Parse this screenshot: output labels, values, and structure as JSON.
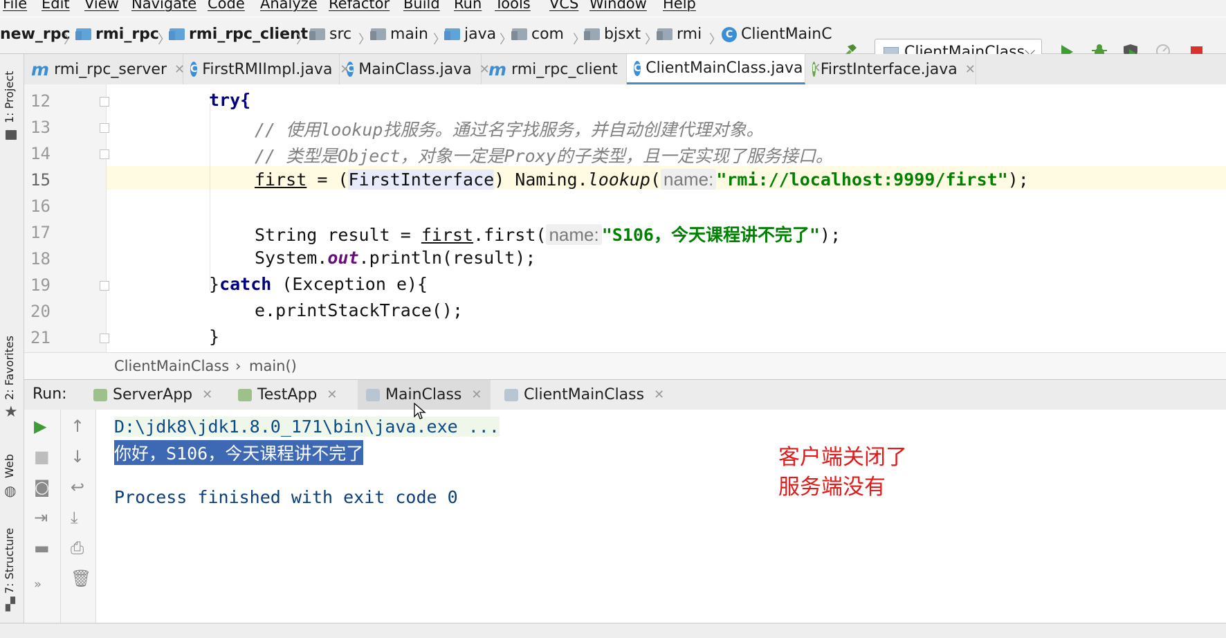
{
  "menu": [
    "File",
    "Edit",
    "View",
    "Navigate",
    "Code",
    "Analyze",
    "Refactor",
    "Build",
    "Run",
    "Tools",
    "VCS",
    "Window",
    "Help"
  ],
  "navbar": {
    "crumbs": [
      "new_rpc",
      "rmi_rpc",
      "rmi_rpc_client",
      "src",
      "main",
      "java",
      "com",
      "bjsxt",
      "rmi",
      "ClientMainC"
    ],
    "run_config": "ClientMainClass"
  },
  "tool_strip": {
    "project": "1: Project",
    "favorites": "2: Favorites",
    "web": "Web",
    "structure": "7: Structure"
  },
  "editor_tabs": [
    {
      "label": "rmi_rpc_server",
      "icon": "maven-module-icon"
    },
    {
      "label": "FirstRMIImpl.java",
      "icon": "class-icon"
    },
    {
      "label": "MainClass.java",
      "icon": "class-icon"
    },
    {
      "label": "rmi_rpc_client",
      "icon": "maven-module-icon"
    },
    {
      "label": "ClientMainClass.java",
      "icon": "class-icon",
      "active": true
    },
    {
      "label": "FirstInterface.java",
      "icon": "interface-icon"
    }
  ],
  "editor": {
    "line_numbers": [
      "12",
      "13",
      "14",
      "15",
      "16",
      "17",
      "18",
      "19",
      "20",
      "21"
    ],
    "current_line": "15",
    "lines": {
      "l12": "try{",
      "l13": "// 使用lookup找服务。通过名字找服务，并自动创建代理对象。",
      "l14": "// 类型是Object，对象一定是Proxy的子类型，且一定实现了服务接口。",
      "l15_var": "first",
      "l15_a": " = (",
      "l15_type": "FirstInterface",
      "l15_b": ") Naming.",
      "l15_method": "lookup",
      "l15_c": "(",
      "l15_hint": "name:",
      "l15_str": "\"rmi://localhost:9999/first\"",
      "l15_end": ");",
      "l17_a": "String result = ",
      "l17_var": "first",
      "l17_b": ".first(",
      "l17_hint": "name:",
      "l17_str": "\"S106，今天课程讲不完了\"",
      "l17_end": ");",
      "l18_a": "System.",
      "l18_field": "out",
      "l18_b": ".println(result);",
      "l19_a": "}",
      "l19_kw": "catch",
      "l19_b": " (Exception e){",
      "l20": "e.printStackTrace();",
      "l21": "}"
    }
  },
  "breadcrumb": {
    "class": "ClientMainClass",
    "method": "main()"
  },
  "run": {
    "label": "Run:",
    "tabs": [
      {
        "label": "ServerApp"
      },
      {
        "label": "TestApp"
      },
      {
        "label": "MainClass",
        "active": true
      },
      {
        "label": "ClientMainClass"
      }
    ],
    "console": {
      "cmd": "D:\\jdk8\\jdk1.8.0_171\\bin\\java.exe ...",
      "output": "你好，S106，今天课程讲不完了",
      "exit": "Process finished with exit code 0"
    }
  },
  "annotation": [
    "客户端关闭了",
    "服务端没有"
  ],
  "colors": {
    "keyword": "#000080",
    "string": "#008000",
    "comment": "#808080",
    "annotation": "#e21a1a",
    "selection": "#3d69b4"
  }
}
